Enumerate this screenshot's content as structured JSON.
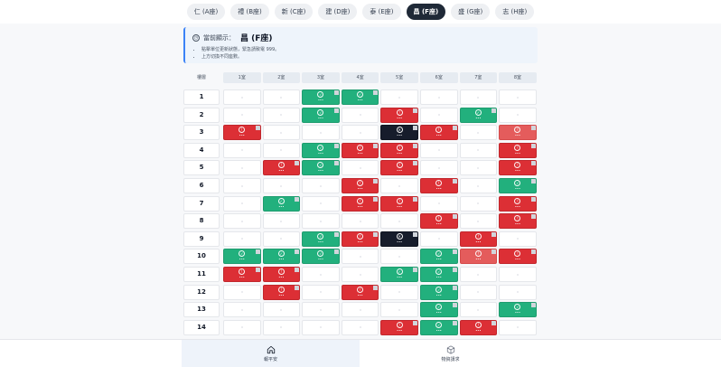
{
  "tabs": [
    {
      "label": "仁 (A座)",
      "active": false
    },
    {
      "label": "禮 (B座)",
      "active": false
    },
    {
      "label": "新 (C座)",
      "active": false
    },
    {
      "label": "建 (D座)",
      "active": false
    },
    {
      "label": "泰 (E座)",
      "active": false
    },
    {
      "label": "昌 (F座)",
      "active": true
    },
    {
      "label": "盛 (G座)",
      "active": false
    },
    {
      "label": "志 (H座)",
      "active": false
    }
  ],
  "info": {
    "label": "當前顯示：",
    "value": "昌 (F座)",
    "notes": [
      "點擊單位更新狀態，緊急請致電 999。",
      "上方切換不同座數。"
    ]
  },
  "grid": {
    "corner_label": "樓層",
    "columns": [
      "1室",
      "2室",
      "3室",
      "4室",
      "5室",
      "6室",
      "7室",
      "8室"
    ],
    "rows": [
      {
        "floor": "1",
        "cells": [
          "empty",
          "empty",
          "green",
          "green",
          "empty",
          "empty",
          "empty",
          "empty"
        ]
      },
      {
        "floor": "2",
        "cells": [
          "empty",
          "empty",
          "green",
          "empty",
          "red",
          "empty",
          "green",
          "empty"
        ]
      },
      {
        "floor": "3",
        "cells": [
          "red",
          "empty",
          "empty",
          "empty",
          "dark",
          "red",
          "empty",
          "pink"
        ]
      },
      {
        "floor": "4",
        "cells": [
          "empty",
          "empty",
          "green",
          "red",
          "red",
          "empty",
          "empty",
          "red"
        ]
      },
      {
        "floor": "5",
        "cells": [
          "empty",
          "red",
          "green",
          "empty",
          "red",
          "empty",
          "empty",
          "red"
        ]
      },
      {
        "floor": "6",
        "cells": [
          "empty",
          "empty",
          "empty",
          "red",
          "empty",
          "red",
          "empty",
          "green"
        ]
      },
      {
        "floor": "7",
        "cells": [
          "empty",
          "green",
          "empty",
          "red",
          "red",
          "empty",
          "empty",
          "red"
        ]
      },
      {
        "floor": "8",
        "cells": [
          "empty",
          "empty",
          "empty",
          "empty",
          "empty",
          "red",
          "empty",
          "red"
        ]
      },
      {
        "floor": "9",
        "cells": [
          "empty",
          "empty",
          "green",
          "red",
          "dark",
          "empty",
          "red",
          "empty"
        ]
      },
      {
        "floor": "10",
        "cells": [
          "green",
          "green",
          "green",
          "empty",
          "empty",
          "green",
          "pink",
          "red"
        ]
      },
      {
        "floor": "11",
        "cells": [
          "red",
          "red",
          "empty",
          "empty",
          "green",
          "green",
          "empty",
          "empty"
        ]
      },
      {
        "floor": "12",
        "cells": [
          "empty",
          "red",
          "empty",
          "red",
          "empty",
          "green",
          "empty",
          "empty"
        ]
      },
      {
        "floor": "13",
        "cells": [
          "empty",
          "empty",
          "empty",
          "empty",
          "empty",
          "green",
          "empty",
          "green"
        ]
      },
      {
        "floor": "14",
        "cells": [
          "empty",
          "empty",
          "empty",
          "empty",
          "red",
          "green",
          "red",
          "empty"
        ]
      }
    ]
  },
  "bottom_nav": [
    {
      "label": "報平安",
      "icon": "home-icon",
      "active": true
    },
    {
      "label": "物資請求",
      "icon": "box-icon",
      "active": false
    }
  ],
  "colors": {
    "green": "#22b07d",
    "red": "#dc2f35",
    "dark": "#161c2b",
    "accent": "#3b82f6"
  }
}
